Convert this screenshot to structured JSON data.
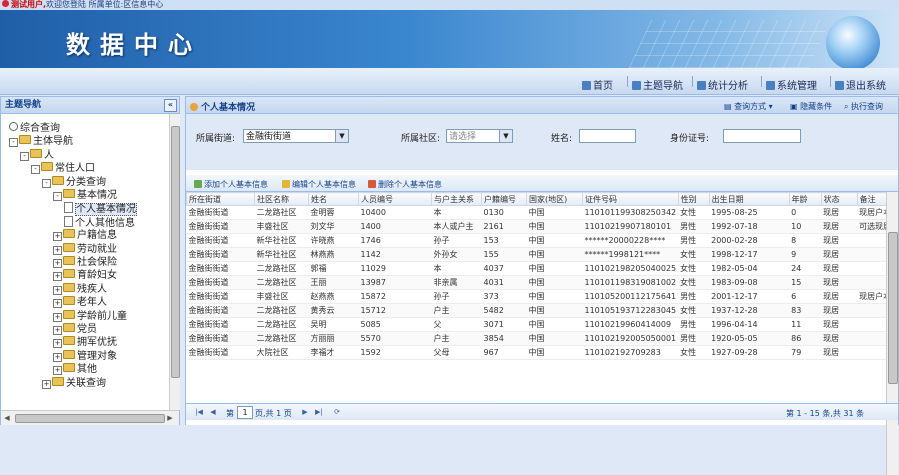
{
  "topbar": {
    "warning": "测试用户,",
    "welcome": "欢迎您登陆 所属单位:区信息中心"
  },
  "banner": {
    "title": "数据中心"
  },
  "nav": {
    "items": [
      {
        "label": "首页",
        "icon": "home-icon"
      },
      {
        "label": "主题导航",
        "icon": "topic-icon"
      },
      {
        "label": "统计分析",
        "icon": "chart-icon"
      },
      {
        "label": "系统管理",
        "icon": "gear-icon"
      },
      {
        "label": "退出系统",
        "icon": "exit-icon"
      }
    ]
  },
  "left": {
    "title": "主题导航",
    "collapse": "«",
    "tree": [
      {
        "label": "综合查询",
        "kind": "radio",
        "level": 0
      },
      {
        "label": "主体导航",
        "kind": "folder",
        "level": 0,
        "pm": "-"
      },
      {
        "label": "人",
        "kind": "folder",
        "level": 1,
        "pm": "-"
      },
      {
        "label": "常住人口",
        "kind": "folder",
        "level": 2,
        "pm": "-"
      },
      {
        "label": "分类查询",
        "kind": "folder",
        "level": 3,
        "pm": "-"
      },
      {
        "label": "基本情况",
        "kind": "folder",
        "level": 4,
        "pm": "-"
      },
      {
        "label": "个人基本情况",
        "kind": "page",
        "level": 5,
        "selected": true
      },
      {
        "label": "个人其他信息",
        "kind": "page",
        "level": 5
      },
      {
        "label": "户籍信息",
        "kind": "folder",
        "level": 4,
        "pm": "+"
      },
      {
        "label": "劳动就业",
        "kind": "folder",
        "level": 4,
        "pm": "+"
      },
      {
        "label": "社会保险",
        "kind": "folder",
        "level": 4,
        "pm": "+"
      },
      {
        "label": "育龄妇女",
        "kind": "folder",
        "level": 4,
        "pm": "+"
      },
      {
        "label": "残疾人",
        "kind": "folder",
        "level": 4,
        "pm": "+"
      },
      {
        "label": "老年人",
        "kind": "folder",
        "level": 4,
        "pm": "+"
      },
      {
        "label": "学龄前儿童",
        "kind": "folder",
        "level": 4,
        "pm": "+"
      },
      {
        "label": "党员",
        "kind": "folder",
        "level": 4,
        "pm": "+"
      },
      {
        "label": "拥军优抚",
        "kind": "folder",
        "level": 4,
        "pm": "+"
      },
      {
        "label": "管理对象",
        "kind": "folder",
        "level": 4,
        "pm": "+"
      },
      {
        "label": "其他",
        "kind": "folder",
        "level": 4,
        "pm": "+"
      },
      {
        "label": "关联查询",
        "kind": "folder",
        "level": 3,
        "pm": "+"
      }
    ]
  },
  "main": {
    "title": "个人基本情况",
    "actions": [
      "查询方式",
      "隐藏条件",
      "执行查询"
    ],
    "filters": {
      "street_label": "所属街道:",
      "street_value": "金融街街道",
      "community_label": "所属社区:",
      "community_value": "请选择",
      "name_label": "姓名:",
      "id_label": "身份证号:"
    },
    "toolbar": [
      "添加个人基本信息",
      "编辑个人基本信息",
      "删除个人基本信息"
    ],
    "columns": [
      "所在街道",
      "社区名称",
      "姓名",
      "人员编号",
      "与户主关系",
      "户籍编号",
      "国家(地区)",
      "证件号码",
      "性别",
      "出生日期",
      "年龄",
      "状态",
      "备注"
    ],
    "rows": [
      [
        "金融街街道",
        "二龙路社区",
        "金明蓉",
        "10400",
        "本",
        "0130",
        "中国",
        "110101199308250342",
        "女性",
        "1995-08-25",
        "0",
        "现居",
        "现居户本"
      ],
      [
        "金融街街道",
        "丰盛社区",
        "刘文华",
        "1400",
        "本人或户主",
        "2161",
        "中国",
        "11010219907180101",
        "男性",
        "1992-07-18",
        "10",
        "现居",
        "可选现居"
      ],
      [
        "金融街街道",
        "新华社社区",
        "许晓燕",
        "1746",
        "孙子",
        "153",
        "中国",
        "******20000228****",
        "男性",
        "2000-02-28",
        "8",
        "现居",
        ""
      ],
      [
        "金融街街道",
        "新华社社区",
        "林燕燕",
        "1142",
        "外孙女",
        "155",
        "中国",
        "******1998121****",
        "女性",
        "1998-12-17",
        "9",
        "现居",
        ""
      ],
      [
        "金融街街道",
        "二龙路社区",
        "郭福",
        "11029",
        "本",
        "4037",
        "中国",
        "110102198205040025",
        "女性",
        "1982-05-04",
        "24",
        "现居",
        ""
      ],
      [
        "金融街街道",
        "二龙路社区",
        "王丽",
        "13987",
        "非亲属",
        "4031",
        "中国",
        "110101198319081002",
        "女性",
        "1983-09-08",
        "15",
        "现居",
        ""
      ],
      [
        "金融街街道",
        "丰盛社区",
        "赵燕燕",
        "15872",
        "孙子",
        "373",
        "中国",
        "110105200112175641",
        "男性",
        "2001-12-17",
        "6",
        "现居",
        "现居户本"
      ],
      [
        "金融街街道",
        "二龙路社区",
        "黄秀云",
        "15712",
        "户主",
        "5482",
        "中国",
        "110105193712283045",
        "女性",
        "1937-12-28",
        "83",
        "现居",
        ""
      ],
      [
        "金融街街道",
        "二龙路社区",
        "吴明",
        "5085",
        "父",
        "3071",
        "中国",
        "11010219960414009",
        "男性",
        "1996-04-14",
        "11",
        "现居",
        ""
      ],
      [
        "金融街街道",
        "二龙路社区",
        "方丽丽",
        "5570",
        "户主",
        "3854",
        "中国",
        "110102192005050001",
        "男性",
        "1920-05-05",
        "86",
        "现居",
        ""
      ],
      [
        "金融街街道",
        "大院社区",
        "李福才",
        "1592",
        "父母",
        "967",
        "中国",
        "110102192709283",
        "女性",
        "1927-09-28",
        "79",
        "现居",
        ""
      ]
    ],
    "pager": {
      "page_label": "第",
      "page_value": "1",
      "total_label": "页,共 1 页",
      "summary": "第 1 - 15 条,共 31 条"
    }
  }
}
